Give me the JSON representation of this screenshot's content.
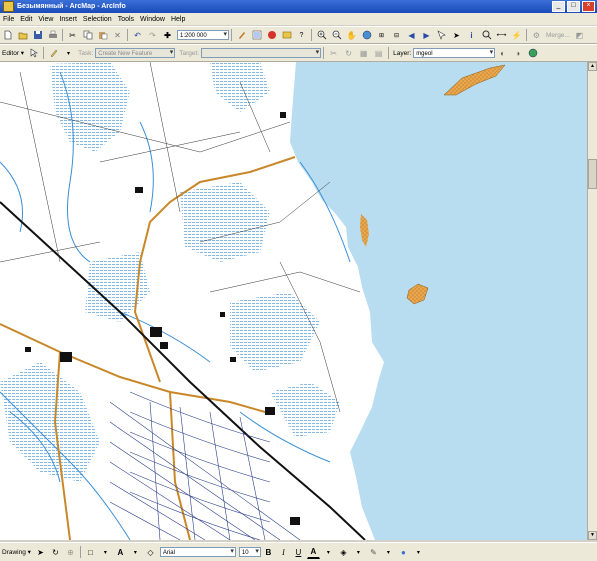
{
  "window": {
    "title": "Безымянный - ArcMap - ArcInfo"
  },
  "menu": [
    "File",
    "Edit",
    "View",
    "Insert",
    "Selection",
    "Tools",
    "Window",
    "Help"
  ],
  "standard_toolbar": {
    "scale": "1:200 000",
    "merge_label": "Merge..."
  },
  "editor_toolbar": {
    "editor_label": "Editor",
    "task_label": "Task:",
    "task_value": "Create New Feature",
    "target_label": "Target:",
    "target_value": "",
    "layer_label": "Layer:",
    "layer_value": "mgeol"
  },
  "drawing_toolbar": {
    "drawing_label": "Drawing",
    "font_name": "Arial",
    "font_size": "10"
  },
  "colors": {
    "sea": "#b8dcf0",
    "water_features": "#3a8fd6",
    "roads": "#c8882a",
    "sand": "#e9a64c"
  }
}
